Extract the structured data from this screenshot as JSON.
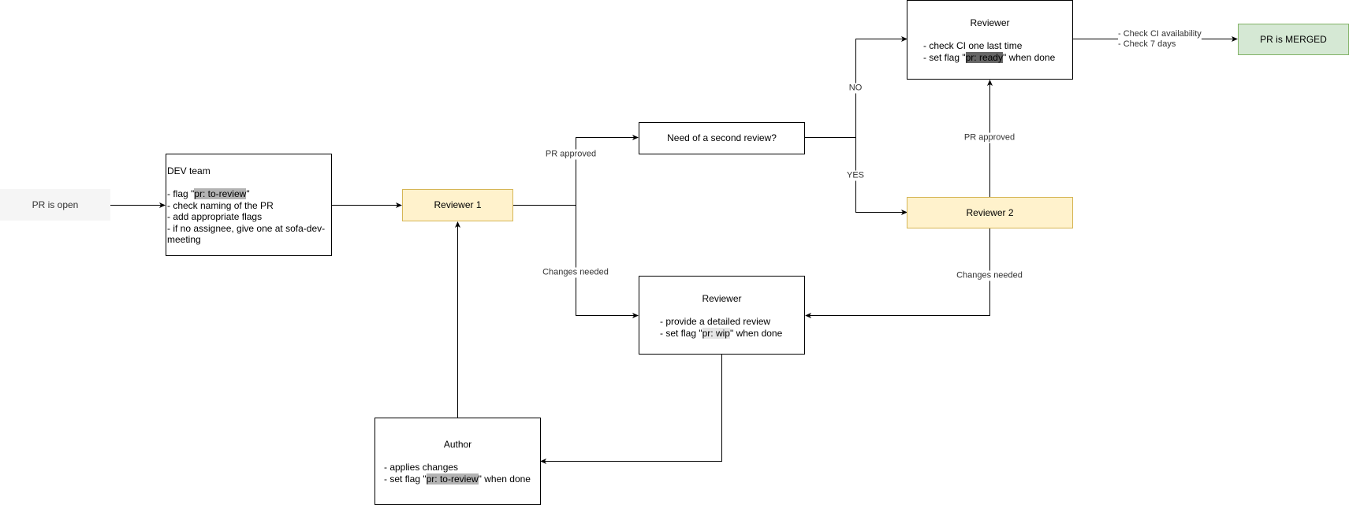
{
  "nodes": {
    "pr_open": {
      "label": "PR is open"
    },
    "dev_team": {
      "title": "DEV team",
      "lines": [
        {
          "pre": "- flag \"",
          "flag": "pr: to-review",
          "post": "\""
        },
        {
          "text": "- check naming of the PR"
        },
        {
          "text": "- add appropriate flags"
        },
        {
          "text": "- if no assignee, give one at sofa-dev-"
        },
        {
          "text": "meeting"
        }
      ]
    },
    "reviewer1": {
      "label": "Reviewer 1"
    },
    "second_review": {
      "label": "Need of a second review?"
    },
    "reviewer_final": {
      "title": "Reviewer",
      "lines": [
        {
          "text": "- check CI one last time"
        },
        {
          "pre": "- set flag \"",
          "flag": "pr: ready",
          "post": "\" when done"
        }
      ]
    },
    "reviewer2": {
      "label": "Reviewer 2"
    },
    "merged": {
      "label": "PR is MERGED"
    },
    "reviewer_detailed": {
      "title": "Reviewer",
      "lines": [
        {
          "text": "- provide a detailed review"
        },
        {
          "pre": "- set flag \"",
          "flag": "pr: wip",
          "post": "\" when done"
        }
      ]
    },
    "author": {
      "title": "Author",
      "lines": [
        {
          "text": "- applies changes"
        },
        {
          "pre": "- set flag \"",
          "flag": "pr: to-review",
          "post": "\" when done"
        }
      ]
    }
  },
  "edge_labels": {
    "r1_approved": "PR approved",
    "r1_changes": "Changes needed",
    "no": "NO",
    "yes": "YES",
    "r2_approved": "PR approved",
    "r2_changes": "Changes needed",
    "merge_checks": [
      "- Check CI availability",
      "- Check 7 days"
    ]
  },
  "colors": {
    "reviewer_fill": "#fff2cc",
    "reviewer_stroke": "#d6b656",
    "merged_fill": "#d5e8d4",
    "merged_stroke": "#82b366",
    "open_fill": "#f5f5f5",
    "flag_highlight": "#b3b3b3",
    "ready_highlight": "#666666",
    "wip_highlight": "#e6e6e6"
  }
}
